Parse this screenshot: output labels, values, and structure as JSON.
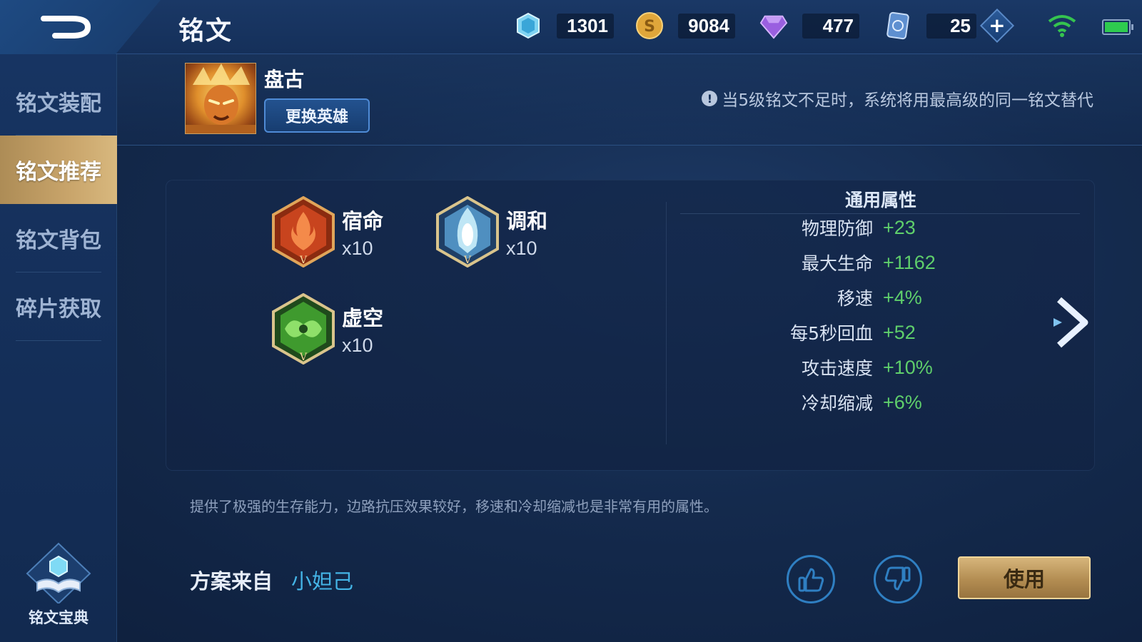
{
  "header": {
    "title": "铭文",
    "currencies": [
      {
        "name": "diamond-coupon",
        "value": "1301"
      },
      {
        "name": "gold",
        "value": "9084"
      },
      {
        "name": "diamond",
        "value": "477"
      },
      {
        "name": "rune-card",
        "value": "25"
      }
    ],
    "plus_label": "+"
  },
  "sidebar": {
    "items": [
      {
        "label": "铭文装配"
      },
      {
        "label": "铭文推荐"
      },
      {
        "label": "铭文背包"
      },
      {
        "label": "碎片获取"
      }
    ],
    "active_index": 1,
    "codex_label": "铭文宝典"
  },
  "hero": {
    "name": "盘古",
    "change_label": "更换英雄",
    "notice_icon": "!",
    "notice": "当5级铭文不足时，系统将用最高级的同一铭文替代"
  },
  "runes": [
    {
      "name": "宿命",
      "count": "x10",
      "color": "#c8441e"
    },
    {
      "name": "调和",
      "count": "x10",
      "color": "#4f8fc0"
    },
    {
      "name": "虚空",
      "count": "x10",
      "color": "#3f9a2e"
    }
  ],
  "attributes": {
    "title": "通用属性",
    "rows": [
      {
        "name": "物理防御",
        "value": "+23"
      },
      {
        "name": "最大生命",
        "value": "+1162"
      },
      {
        "name": "移速",
        "value": "+4%"
      },
      {
        "name": "每5秒回血",
        "value": "+52"
      },
      {
        "name": "攻击速度",
        "value": "+10%"
      },
      {
        "name": "冷却缩减",
        "value": "+6%"
      }
    ]
  },
  "description": "提供了极强的生存能力，边路抗压效果较好，移速和冷却缩减也是非常有用的属性。",
  "footer": {
    "author_label": "方案来自",
    "author_name": "小妲己",
    "use_label": "使用"
  },
  "colors": {
    "active_tab": "#c9a56b",
    "stat_value": "#5fcf6b",
    "author_name": "#44b4e6",
    "use_button": "#b38d52"
  }
}
